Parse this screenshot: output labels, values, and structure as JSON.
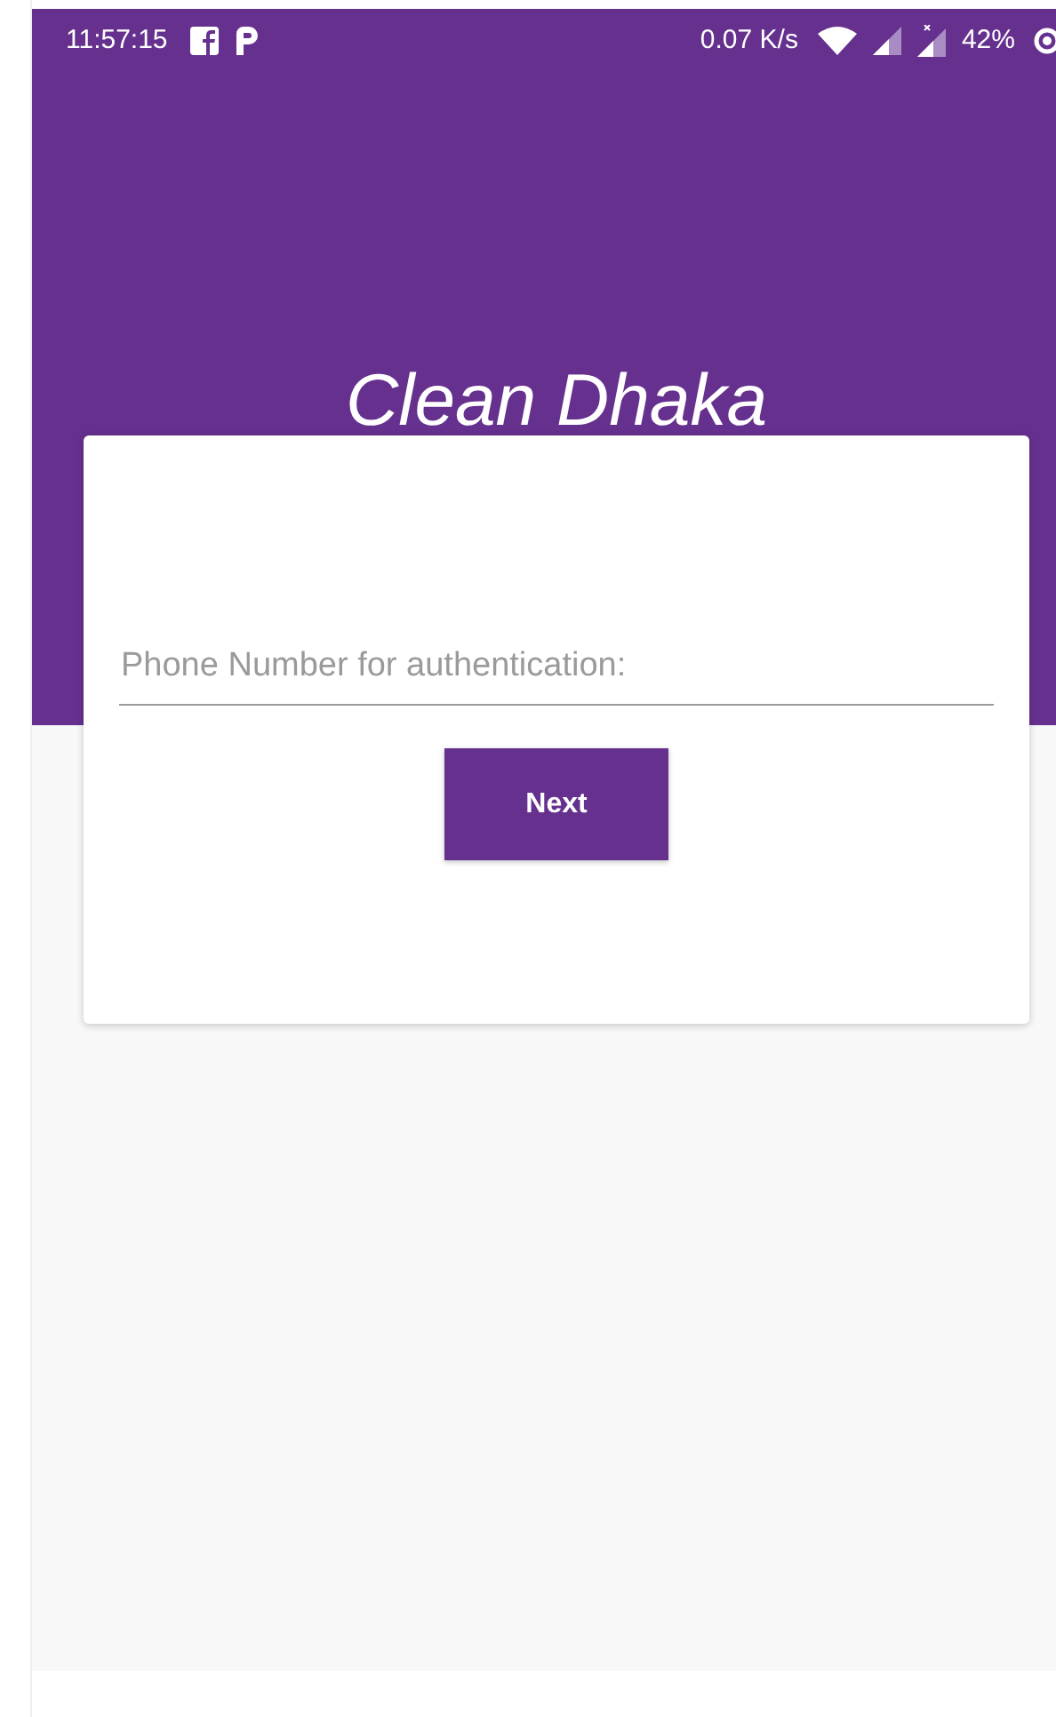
{
  "status_bar": {
    "time": "11:57:15",
    "net_speed": "0.07 K/s",
    "battery": "42%"
  },
  "app": {
    "title": "Clean Dhaka"
  },
  "form": {
    "phone_field": {
      "placeholder": "Phone Number for authentication:"
    },
    "button": "Next"
  }
}
